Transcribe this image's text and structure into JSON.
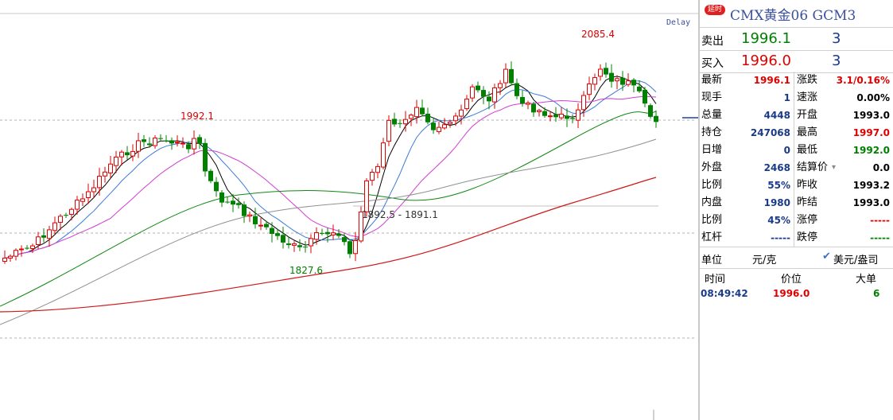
{
  "chart": {
    "delay_label": "Delay",
    "annotations": {
      "high": "2085.4",
      "left_peak": "1992.1",
      "low": "1827.6",
      "range": "1892.5 - 1891.1"
    }
  },
  "panel": {
    "badge": "延时",
    "title": "CMX黄金06  GCM3",
    "sell": {
      "label": "卖出",
      "price": "1996.1",
      "volume": "3"
    },
    "buy": {
      "label": "买入",
      "price": "1996.0",
      "volume": "3"
    },
    "left": [
      {
        "label": "最新",
        "value": "1996.1",
        "color": "#e00000"
      },
      {
        "label": "现手",
        "value": "1",
        "color": "#1a3a8a"
      },
      {
        "label": "总量",
        "value": "4448",
        "color": "#1a3a8a"
      },
      {
        "label": "持仓",
        "value": "247068",
        "color": "#1a3a8a"
      },
      {
        "label": "日增",
        "value": "0",
        "color": "#1a3a8a"
      },
      {
        "label": "外盘",
        "value": "2468",
        "color": "#1a3a8a"
      },
      {
        "label": "比例",
        "value": "55%",
        "color": "#1a3a8a"
      },
      {
        "label": "内盘",
        "value": "1980",
        "color": "#1a3a8a"
      },
      {
        "label": "比例",
        "value": "45%",
        "color": "#1a3a8a"
      },
      {
        "label": "杠杆",
        "value": "-----",
        "color": "#1a3a8a"
      }
    ],
    "right": [
      {
        "label": "涨跌",
        "value": "3.1/0.16%",
        "color": "#e00000"
      },
      {
        "label": "速涨",
        "value": "0.00%",
        "color": "#000000"
      },
      {
        "label": "开盘",
        "value": "1993.0",
        "color": "#000000"
      },
      {
        "label": "最高",
        "value": "1997.0",
        "color": "#e00000"
      },
      {
        "label": "最低",
        "value": "1992.0",
        "color": "#008000"
      },
      {
        "label": "结算价",
        "value": "0.0",
        "color": "#000000"
      },
      {
        "label": "昨收",
        "value": "1993.2",
        "color": "#000000"
      },
      {
        "label": "昨结",
        "value": "1993.0",
        "color": "#000000"
      },
      {
        "label": "涨停",
        "value": "-----",
        "color": "#e00000"
      },
      {
        "label": "跌停",
        "value": "-----",
        "color": "#008000"
      }
    ],
    "unit": {
      "label": "单位",
      "value": "元/克",
      "option": "美元/盎司"
    },
    "trades_header": {
      "time": "时间",
      "price": "价位",
      "volume": "大单"
    },
    "trades": [
      {
        "time": "08:49:42",
        "price": "1996.0",
        "volume": "6"
      }
    ]
  },
  "colors": {
    "up": "#e00000",
    "down": "#008000",
    "ma_black": "#000000",
    "ma_blue": "#3a7ad8",
    "ma_magenta": "#d23cd2",
    "ma_green": "#118811",
    "ma_gray": "#909090",
    "ma_red": "#d01818"
  }
}
